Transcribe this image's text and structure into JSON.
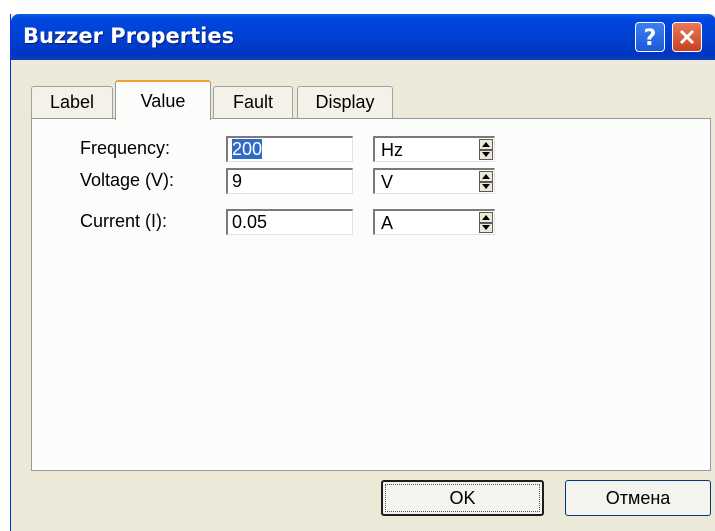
{
  "window": {
    "title": "Buzzer Properties"
  },
  "tabs": [
    {
      "label": "Label",
      "active": false
    },
    {
      "label": "Value",
      "active": true
    },
    {
      "label": "Fault",
      "active": false
    },
    {
      "label": "Display",
      "active": false
    }
  ],
  "fields": [
    {
      "label": "Frequency:",
      "value": "200",
      "unit": "Hz",
      "selected": true
    },
    {
      "label": "Voltage (V):",
      "value": "9",
      "unit": "V",
      "selected": false
    },
    {
      "label": "Current (I):",
      "value": "0.05",
      "unit": "A",
      "selected": false
    }
  ],
  "buttons": {
    "ok": "OK",
    "cancel": "Отмена"
  },
  "colors": {
    "titlebar": "#0041d4",
    "dialog_background": "#ece9d8",
    "selection": "#316ac5",
    "close_button": "#c8411f"
  },
  "icons": {
    "help": "help-icon",
    "close": "close-icon"
  }
}
